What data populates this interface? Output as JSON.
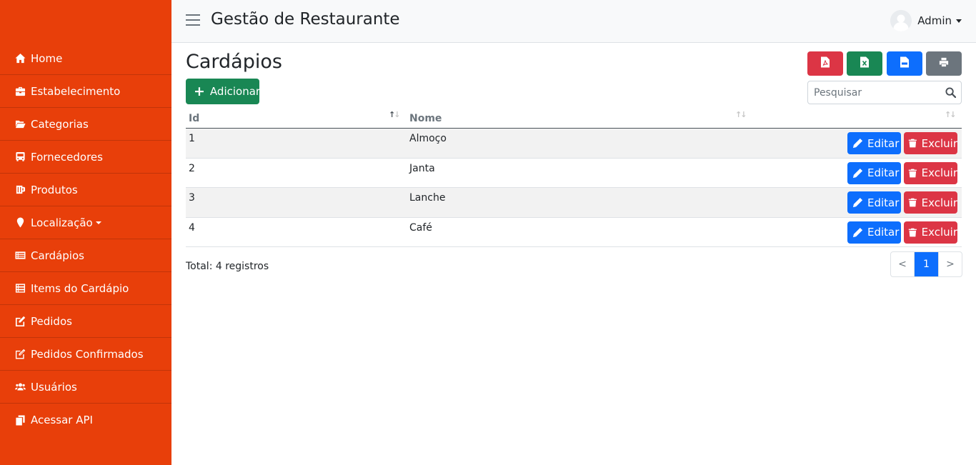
{
  "colors": {
    "sidebar": "#e83f0a",
    "primary": "#0d6efd",
    "success": "#198754",
    "danger": "#dc3545",
    "secondary": "#6c757d"
  },
  "header": {
    "title": "Gestão de Restaurante",
    "user": "Admin"
  },
  "sidebar": {
    "items": [
      {
        "label": "Home",
        "icon": "home-icon"
      },
      {
        "label": "Estabelecimento",
        "icon": "briefcase-icon"
      },
      {
        "label": "Categorias",
        "icon": "folder-open-icon"
      },
      {
        "label": "Fornecedores",
        "icon": "bus-icon"
      },
      {
        "label": "Produtos",
        "icon": "mug-icon"
      },
      {
        "label": "Localização",
        "icon": "map-marker-icon"
      },
      {
        "label": "Cardápios",
        "icon": "list-alt-icon"
      },
      {
        "label": "Items do Cardápio",
        "icon": "list-icon"
      },
      {
        "label": "Pedidos",
        "icon": "edit-icon"
      },
      {
        "label": "Pedidos Confirmados",
        "icon": "edit-outline-icon"
      },
      {
        "label": "Usuários",
        "icon": "users-icon"
      },
      {
        "label": "Acessar API",
        "icon": "copy-icon"
      }
    ]
  },
  "main": {
    "title": "Cardápios",
    "add_label": "Adicionar",
    "search_placeholder": "Pesquisar",
    "export": [
      {
        "name": "pdf",
        "icon": "file-pdf-icon"
      },
      {
        "name": "excel",
        "icon": "file-excel-icon"
      },
      {
        "name": "csv",
        "icon": "file-csv-icon"
      },
      {
        "name": "print",
        "icon": "print-icon"
      }
    ],
    "table": {
      "columns": [
        "Id",
        "Nome"
      ],
      "rows": [
        {
          "id": "1",
          "nome": "Almoço"
        },
        {
          "id": "2",
          "nome": "Janta"
        },
        {
          "id": "3",
          "nome": "Lanche"
        },
        {
          "id": "4",
          "nome": "Café"
        }
      ],
      "edit_label": "Editar",
      "delete_label": "Excluir"
    },
    "total": "Total: 4 registros",
    "pagination": {
      "prev": "<",
      "current": "1",
      "next": ">"
    }
  }
}
